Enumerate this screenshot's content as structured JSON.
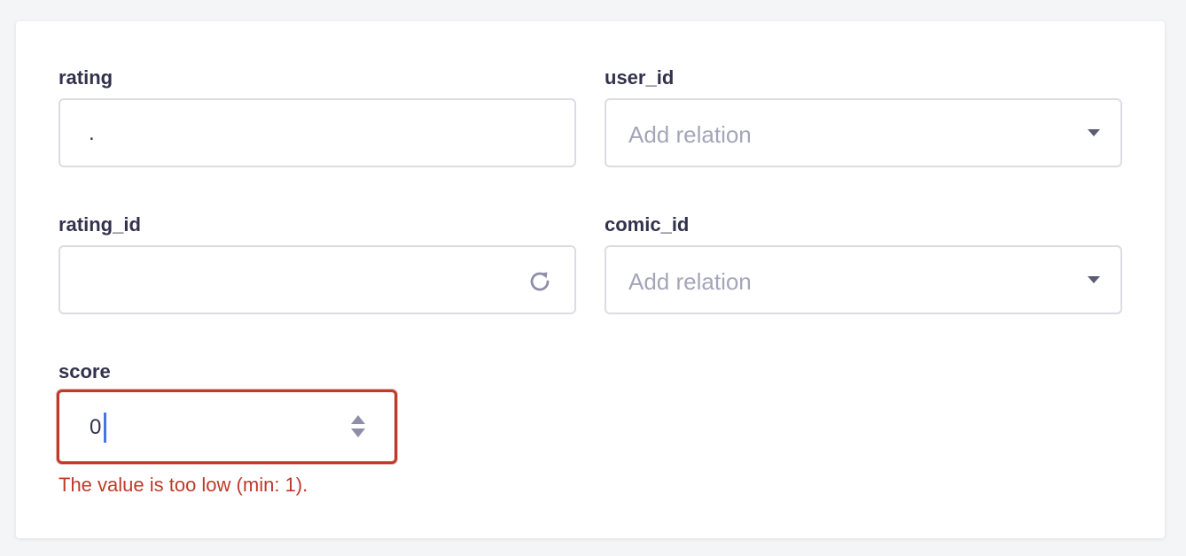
{
  "form": {
    "rating": {
      "label": "rating",
      "value": "."
    },
    "user_id": {
      "label": "user_id",
      "placeholder": "Add relation"
    },
    "rating_id": {
      "label": "rating_id",
      "value": ""
    },
    "comic_id": {
      "label": "comic_id",
      "placeholder": "Add relation"
    },
    "score": {
      "label": "score",
      "value": "0",
      "error": "The value is too low (min: 1)."
    }
  },
  "icons": {
    "regenerate": "refresh-icon",
    "dropdown": "chevron-down-icon",
    "stepper": "number-stepper-icon"
  },
  "colors": {
    "error": "#c0392b",
    "label": "#32324d",
    "placeholder": "#a5a5ba",
    "border": "#dcdce4",
    "cursor": "#4b73e8"
  }
}
